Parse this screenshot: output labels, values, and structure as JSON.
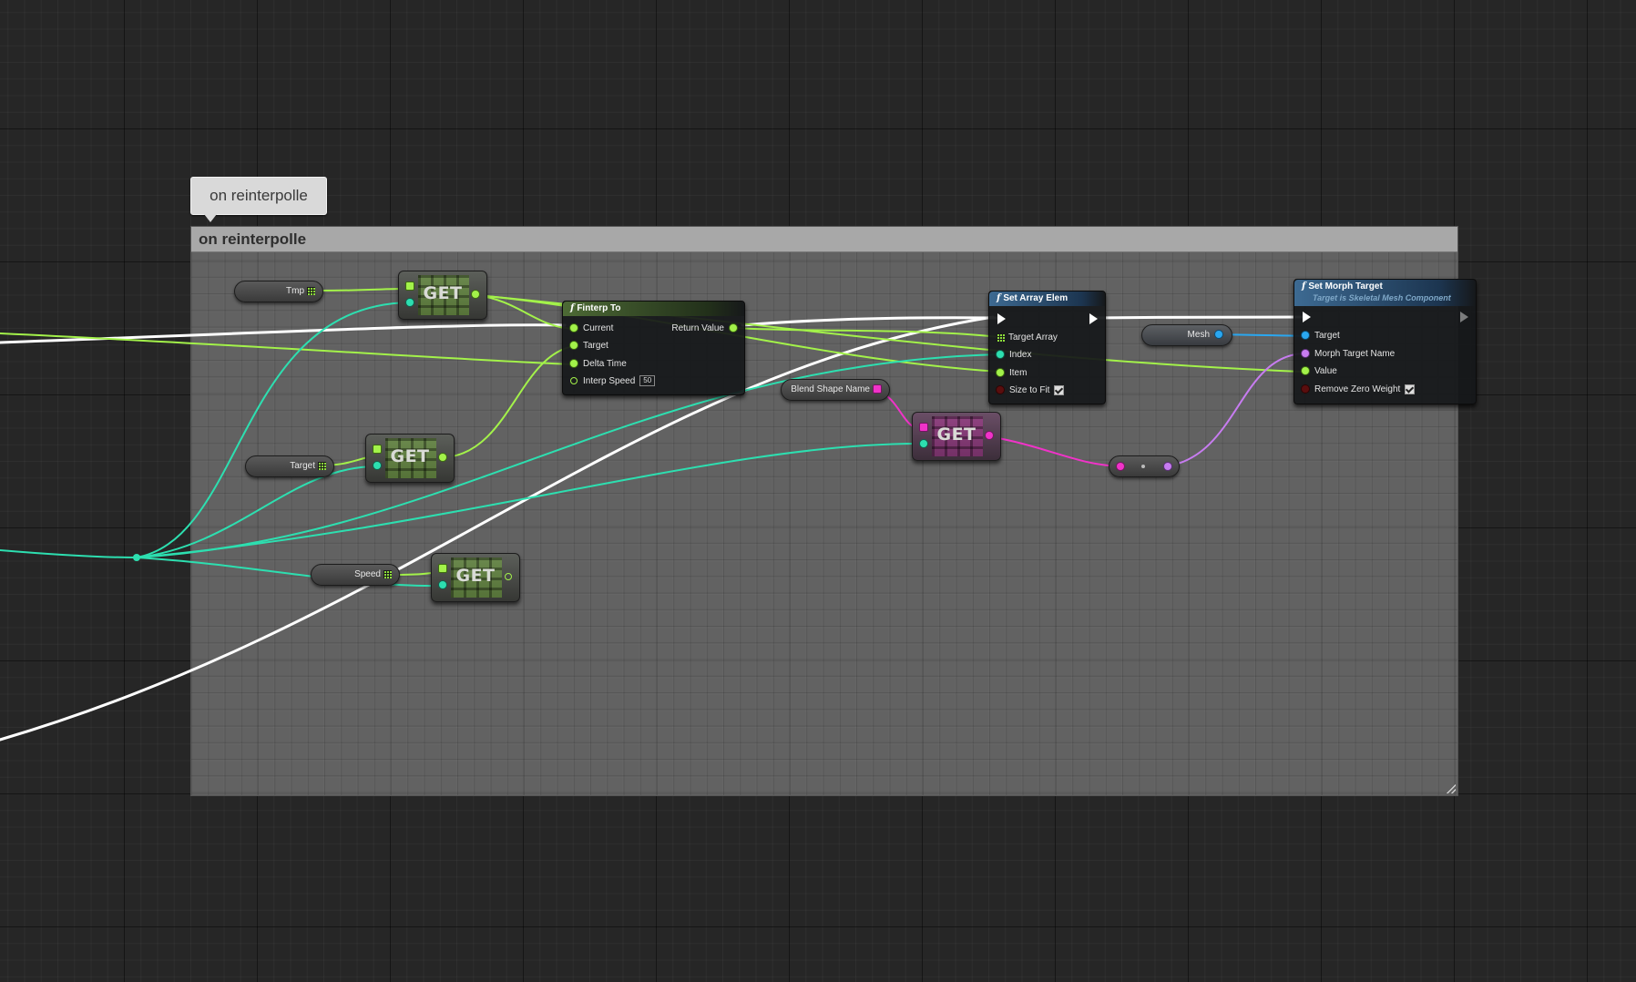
{
  "comment": {
    "bubble_text": "on reinterpolle",
    "header_title": "on reinterpolle"
  },
  "variables": {
    "tmp": "Tmp",
    "target": "Target",
    "speed": "Speed",
    "blend_shape_name": "Blend Shape Name",
    "mesh": "Mesh"
  },
  "get_nodes": {
    "label": "GET"
  },
  "finterp": {
    "title": "Finterp To",
    "current": "Current",
    "target": "Target",
    "delta_time": "Delta Time",
    "interp_speed": "Interp Speed",
    "interp_speed_value": "50",
    "return_value": "Return Value"
  },
  "set_array_elem": {
    "title": "Set Array Elem",
    "target_array": "Target Array",
    "index": "Index",
    "item": "Item",
    "size_to_fit": "Size to Fit"
  },
  "set_morph_target": {
    "title": "Set Morph Target",
    "subtitle": "Target is Skeletal Mesh Component",
    "target": "Target",
    "morph_target_name": "Morph Target Name",
    "value": "Value",
    "remove_zero_weight": "Remove Zero Weight"
  },
  "colors": {
    "exec_wire": "#ffffff",
    "float_wire": "#a3f24a",
    "int_wire": "#2ddfb0",
    "object_wire": "#2aa7f0",
    "name_wire": "#f033c8",
    "string_wire": "#c77cf0"
  }
}
